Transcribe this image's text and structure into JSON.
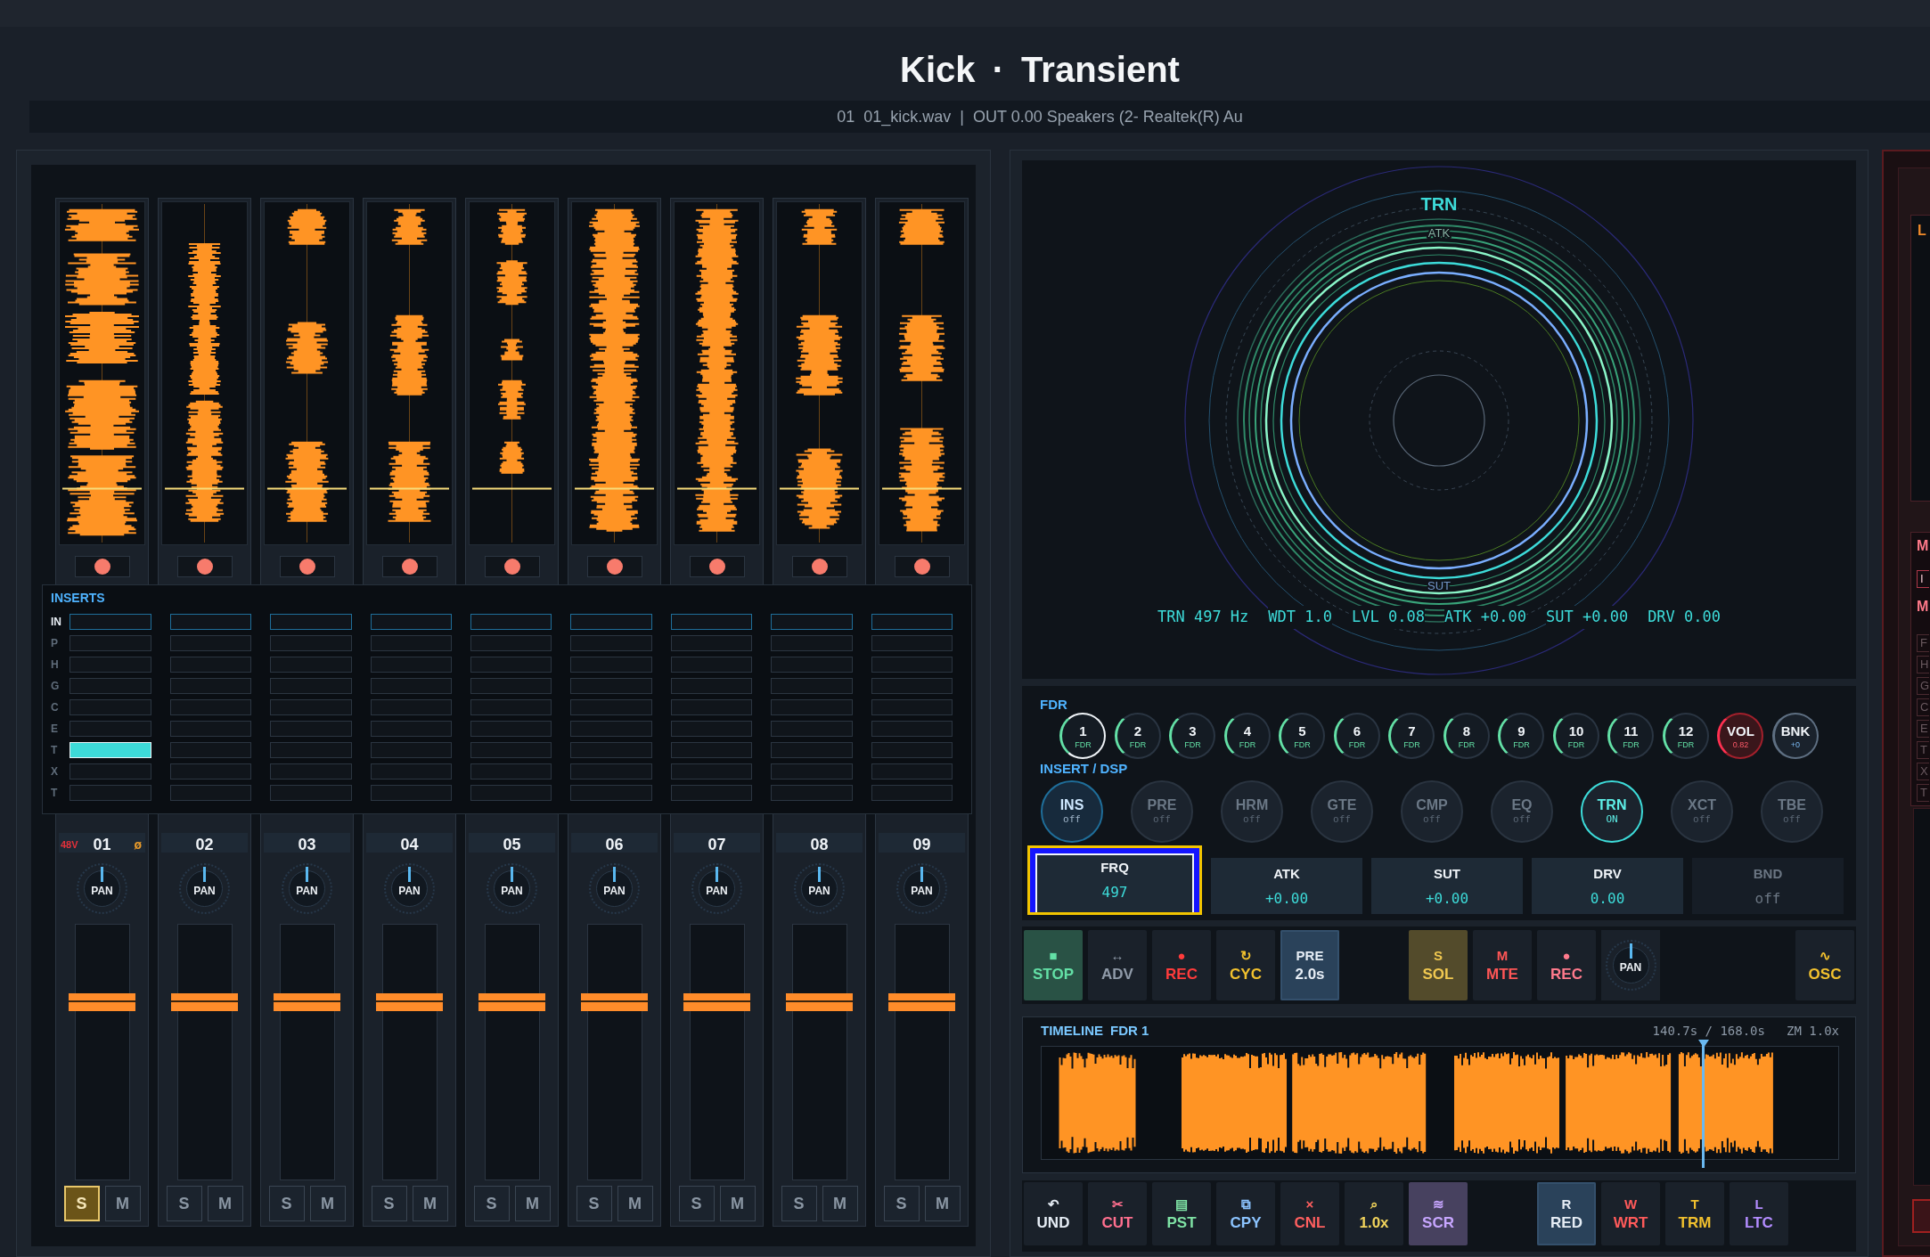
{
  "header": {
    "title": "Kick · Transient",
    "status": [
      "01",
      "01_kick.wav",
      "|",
      "OUT 0.00 Speakers (2- Realtek(R) Au"
    ]
  },
  "mixer": {
    "channels": [
      {
        "number": "01",
        "phantom": "48V",
        "phase": "ø",
        "armed": true,
        "pan": {
          "label": "PAN",
          "level": 0.5
        },
        "fader": {
          "level": 0.71
        },
        "solo": {
          "label": "S",
          "on": true
        },
        "mute": {
          "label": "M",
          "on": false
        }
      },
      {
        "number": "02",
        "armed": true,
        "pan": {
          "label": "PAN",
          "level": 0.5
        },
        "fader": {
          "level": 0.71
        },
        "solo": {
          "label": "S",
          "on": false
        },
        "mute": {
          "label": "M",
          "on": false
        }
      },
      {
        "number": "03",
        "armed": true,
        "pan": {
          "label": "PAN",
          "level": 0.5
        },
        "fader": {
          "level": 0.71
        },
        "solo": {
          "label": "S",
          "on": false
        },
        "mute": {
          "label": "M",
          "on": false
        }
      },
      {
        "number": "04",
        "armed": true,
        "pan": {
          "label": "PAN",
          "level": 0.5
        },
        "fader": {
          "level": 0.71
        },
        "solo": {
          "label": "S",
          "on": false
        },
        "mute": {
          "label": "M",
          "on": false
        }
      },
      {
        "number": "05",
        "armed": true,
        "pan": {
          "label": "PAN",
          "level": 0.5
        },
        "fader": {
          "level": 0.71
        },
        "solo": {
          "label": "S",
          "on": false
        },
        "mute": {
          "label": "M",
          "on": false
        }
      },
      {
        "number": "06",
        "armed": true,
        "pan": {
          "label": "PAN",
          "level": 0.5
        },
        "fader": {
          "level": 0.71
        },
        "solo": {
          "label": "S",
          "on": false
        },
        "mute": {
          "label": "M",
          "on": false
        }
      },
      {
        "number": "07",
        "armed": true,
        "pan": {
          "label": "PAN",
          "level": 0.5
        },
        "fader": {
          "level": 0.71
        },
        "solo": {
          "label": "S",
          "on": false
        },
        "mute": {
          "label": "M",
          "on": false
        }
      },
      {
        "number": "08",
        "armed": true,
        "pan": {
          "label": "PAN",
          "level": 0.5
        },
        "fader": {
          "level": 0.71
        },
        "solo": {
          "label": "S",
          "on": false
        },
        "mute": {
          "label": "M",
          "on": false
        }
      },
      {
        "number": "09",
        "armed": true,
        "pan": {
          "label": "PAN",
          "level": 0.5
        },
        "fader": {
          "level": 0.71
        },
        "solo": {
          "label": "S",
          "on": false
        },
        "mute": {
          "label": "M",
          "on": false
        }
      }
    ]
  },
  "inserts": {
    "title": "INSERTS",
    "rows": [
      {
        "label": "IN",
        "selected": true,
        "slots": [
          false,
          false,
          false,
          false,
          false,
          false,
          false,
          false,
          false
        ]
      },
      {
        "label": "P",
        "selected": false,
        "slots": [
          false,
          false,
          false,
          false,
          false,
          false,
          false,
          false,
          false
        ]
      },
      {
        "label": "H",
        "selected": false,
        "slots": [
          false,
          false,
          false,
          false,
          false,
          false,
          false,
          false,
          false
        ]
      },
      {
        "label": "G",
        "selected": false,
        "slots": [
          false,
          false,
          false,
          false,
          false,
          false,
          false,
          false,
          false
        ]
      },
      {
        "label": "C",
        "selected": false,
        "slots": [
          false,
          false,
          false,
          false,
          false,
          false,
          false,
          false,
          false
        ]
      },
      {
        "label": "E",
        "selected": false,
        "slots": [
          false,
          false,
          false,
          false,
          false,
          false,
          false,
          false,
          false
        ]
      },
      {
        "label": "T",
        "selected": false,
        "slots": [
          true,
          false,
          false,
          false,
          false,
          false,
          false,
          false,
          false
        ]
      },
      {
        "label": "X",
        "selected": false,
        "slots": [
          false,
          false,
          false,
          false,
          false,
          false,
          false,
          false,
          false
        ]
      },
      {
        "label": "T",
        "selected": false,
        "slots": [
          false,
          false,
          false,
          false,
          false,
          false,
          false,
          false,
          false
        ]
      }
    ]
  },
  "visualizer": {
    "title": "TRN",
    "top_label": "ATK",
    "bottom_label": "SUT",
    "readout": [
      "TRN 497 Hz",
      "WDT 1.0",
      "LVL 0.08",
      "ATK +0.00",
      "SUT +0.00",
      "DRV 0.00"
    ]
  },
  "fader_bank": {
    "title": "FDR",
    "knobs": [
      {
        "kind": "fader",
        "label": "1",
        "sublabel": "FDR",
        "selected": true
      },
      {
        "kind": "fader",
        "label": "2",
        "sublabel": "FDR",
        "selected": false
      },
      {
        "kind": "fader",
        "label": "3",
        "sublabel": "FDR",
        "selected": false
      },
      {
        "kind": "fader",
        "label": "4",
        "sublabel": "FDR",
        "selected": false
      },
      {
        "kind": "fader",
        "label": "5",
        "sublabel": "FDR",
        "selected": false
      },
      {
        "kind": "fader",
        "label": "6",
        "sublabel": "FDR",
        "selected": false
      },
      {
        "kind": "fader",
        "label": "7",
        "sublabel": "FDR",
        "selected": false
      },
      {
        "kind": "fader",
        "label": "8",
        "sublabel": "FDR",
        "selected": false
      },
      {
        "kind": "fader",
        "label": "9",
        "sublabel": "FDR",
        "selected": false
      },
      {
        "kind": "fader",
        "label": "10",
        "sublabel": "FDR",
        "selected": false
      },
      {
        "kind": "fader",
        "label": "11",
        "sublabel": "FDR",
        "selected": false
      },
      {
        "kind": "fader",
        "label": "12",
        "sublabel": "FDR",
        "selected": false
      },
      {
        "kind": "volume",
        "label": "VOL",
        "sublabel": "0.82",
        "selected": false
      },
      {
        "kind": "bank",
        "label": "BNK",
        "sublabel": "+0",
        "selected": false
      }
    ]
  },
  "dsp": {
    "title": "INSERT / DSP",
    "modules": [
      {
        "label": "INS",
        "status": "off",
        "on": false,
        "selected": true
      },
      {
        "label": "PRE",
        "status": "off",
        "on": false,
        "selected": false
      },
      {
        "label": "HRM",
        "status": "off",
        "on": false,
        "selected": false
      },
      {
        "label": "GTE",
        "status": "off",
        "on": false,
        "selected": false
      },
      {
        "label": "CMP",
        "status": "off",
        "on": false,
        "selected": false
      },
      {
        "label": "EQ",
        "status": "off",
        "on": false,
        "selected": false
      },
      {
        "label": "TRN",
        "status": "ON",
        "on": true,
        "selected": false
      },
      {
        "label": "XCT",
        "status": "off",
        "on": false,
        "selected": false
      },
      {
        "label": "TBE",
        "status": "off",
        "on": false,
        "selected": false
      }
    ]
  },
  "params": [
    {
      "label": "FRQ",
      "value": "497",
      "selected": true,
      "disabled": false
    },
    {
      "label": "ATK",
      "value": "+0.00",
      "selected": false,
      "disabled": false
    },
    {
      "label": "SUT",
      "value": "+0.00",
      "selected": false,
      "disabled": false
    },
    {
      "label": "DRV",
      "value": "0.00",
      "selected": false,
      "disabled": false
    },
    {
      "label": "BND",
      "value": "off",
      "selected": false,
      "disabled": true
    }
  ],
  "transport": {
    "groups": [
      {
        "items": [
          {
            "kind": "button",
            "top": "■",
            "label": "STOP",
            "color": "#63e0a6",
            "on": true,
            "selected": false
          },
          {
            "kind": "button",
            "top": "↔",
            "label": "ADV",
            "color": "#8f9aa8",
            "on": false,
            "selected": false
          },
          {
            "kind": "button",
            "top": "●",
            "label": "REC",
            "color": "#ff3b3b",
            "on": false,
            "selected": false
          },
          {
            "kind": "button",
            "top": "↻",
            "label": "CYC",
            "color": "#f2c12e",
            "on": false,
            "selected": false
          },
          {
            "kind": "button",
            "top": "PRE",
            "label": "2.0s",
            "color": "#e6edf5",
            "on": false,
            "selected": true
          }
        ]
      },
      {
        "items": [
          {
            "kind": "button",
            "top": "S",
            "label": "SOL",
            "color": "#f0c850",
            "on": true,
            "selected": false
          },
          {
            "kind": "button",
            "top": "M",
            "label": "MTE",
            "color": "#ff5656",
            "on": false,
            "selected": false
          },
          {
            "kind": "button",
            "top": "●",
            "label": "REC",
            "color": "#ff7a8c",
            "on": false,
            "selected": false
          },
          {
            "kind": "knob",
            "label": "PAN",
            "level": 0.5
          }
        ]
      },
      {
        "items": [
          {
            "kind": "button",
            "top": "∿",
            "label": "OSC",
            "color": "#f2c12e",
            "on": false,
            "selected": false
          }
        ]
      }
    ]
  },
  "timeline": {
    "title": "TIMELINE",
    "track": "FDR 1",
    "time": "140.7s / 168.0s",
    "zoom": "ZM 1.0x",
    "level": 0.8375
  },
  "edit_toolbar": {
    "groups": [
      {
        "items": [
          {
            "kind": "button",
            "top": "↶",
            "label": "UND",
            "color": "#e6edf5",
            "on": false,
            "selected": false
          },
          {
            "kind": "button",
            "top": "✂",
            "label": "CUT",
            "color": "#ff6f8e",
            "on": false,
            "selected": false
          },
          {
            "kind": "button",
            "top": "▤",
            "label": "PST",
            "color": "#7fe3a5",
            "on": false,
            "selected": false
          },
          {
            "kind": "button",
            "top": "⧉",
            "label": "CPY",
            "color": "#8cc4ff",
            "on": false,
            "selected": false
          },
          {
            "kind": "button",
            "top": "×",
            "label": "CNL",
            "color": "#ff5f5f",
            "on": false,
            "selected": false
          },
          {
            "kind": "button",
            "top": "⌕",
            "label": "1.0x",
            "color": "#f2d45c",
            "on": false,
            "selected": false
          },
          {
            "kind": "button",
            "top": "≋",
            "label": "SCR",
            "color": "#c7a6ff",
            "on": true,
            "selected": false
          }
        ]
      },
      {
        "items": [
          {
            "kind": "button",
            "top": "R",
            "label": "RED",
            "color": "#e6edf5",
            "on": false,
            "selected": true
          },
          {
            "kind": "button",
            "top": "W",
            "label": "WRT",
            "color": "#ff5a5a",
            "on": false,
            "selected": false
          },
          {
            "kind": "button",
            "top": "T",
            "label": "TRM",
            "color": "#f2c12e",
            "on": false,
            "selected": false
          },
          {
            "kind": "button",
            "top": "L",
            "label": "LTC",
            "color": "#b38cff",
            "on": false,
            "selected": false
          }
        ]
      }
    ]
  },
  "side_panel": {
    "top_label": "L",
    "sections": [
      {
        "heading": "M",
        "slots": [
          {
            "text": "I",
            "selected": true
          }
        ]
      },
      {
        "heading": "M",
        "slots": [
          {
            "text": "F",
            "selected": false
          },
          {
            "text": "H",
            "selected": false
          },
          {
            "text": "G",
            "selected": false
          },
          {
            "text": "C",
            "selected": false
          },
          {
            "text": "E",
            "selected": false
          },
          {
            "text": "T",
            "selected": false
          },
          {
            "text": "X",
            "selected": false
          },
          {
            "text": "T",
            "selected": false
          }
        ]
      }
    ]
  }
}
